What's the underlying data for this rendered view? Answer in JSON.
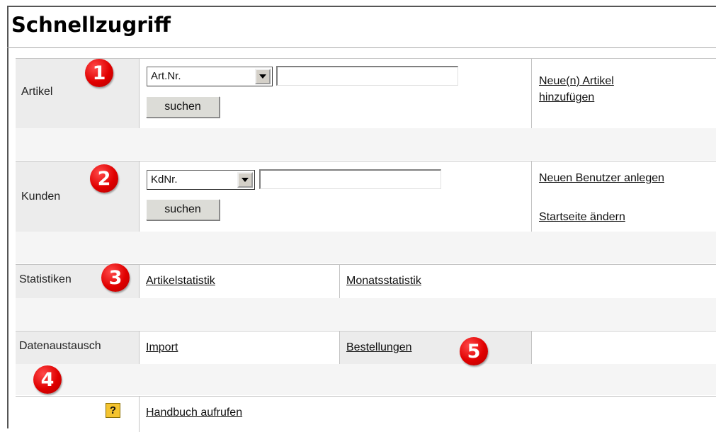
{
  "title": "Schnellzugriff",
  "colors": {
    "badge": "#e00000",
    "label_bg": "#ececec",
    "help_icon": "#f4c430"
  },
  "artikel": {
    "label": "Artikel",
    "badge": "1",
    "select_value": "Art.Nr.",
    "search_value": "",
    "search_button": "suchen",
    "link_add": "Neue(n) Artikel hinzufügen"
  },
  "kunden": {
    "label": "Kunden",
    "badge": "2",
    "select_value": "KdNr.",
    "search_value": "",
    "search_button": "suchen",
    "link_new_user": "Neuen Benutzer anlegen",
    "link_startpage": "Startseite ändern"
  },
  "statistiken": {
    "label": "Statistiken",
    "badge": "3",
    "link_article_stats": "Artikelstatistik",
    "link_month_stats": "Monatsstatistik"
  },
  "datenaustausch": {
    "label": "Datenaustausch",
    "badge_4": "4",
    "badge_5": "5",
    "link_import": "Import",
    "link_orders": "Bestellungen"
  },
  "help": {
    "icon_text": "?",
    "link": "Handbuch aufrufen"
  }
}
